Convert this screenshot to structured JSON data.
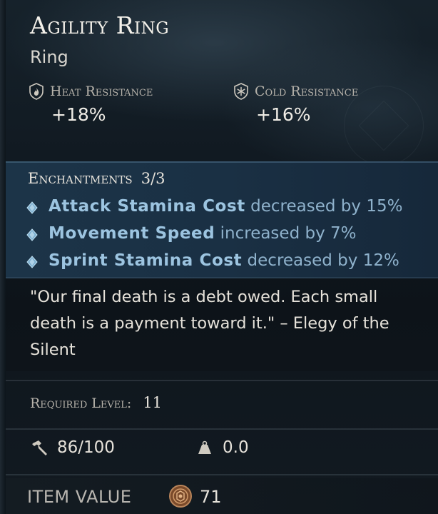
{
  "item": {
    "name": "Agility Ring",
    "type": "Ring"
  },
  "resistances": [
    {
      "label": "Heat Resistance",
      "value": "+18%",
      "icon": "flame-shield-icon"
    },
    {
      "label": "Cold Resistance",
      "value": "+16%",
      "icon": "snowflake-shield-icon"
    }
  ],
  "enchantments": {
    "title": "Enchantments",
    "count": "3/3",
    "items": [
      {
        "name": "Attack Stamina Cost",
        "desc": "decreased by 15%"
      },
      {
        "name": "Movement Speed",
        "desc": "increased by 7%"
      },
      {
        "name": "Sprint Stamina Cost",
        "desc": "decreased by 12%"
      }
    ]
  },
  "lore": "\"Our final death is a debt owed. Each small death is a payment toward it.\" – Elegy of the Silent",
  "requirement": {
    "label": "Required Level:",
    "value": "11"
  },
  "stats": {
    "durability": "86/100",
    "weight": "0.0"
  },
  "value": {
    "label": "ITEM VALUE",
    "amount": "71"
  },
  "colors": {
    "enchant_name": "#9cc4e0",
    "enchant_desc": "#8fb2cc",
    "enchant_band": "#1c3448"
  }
}
